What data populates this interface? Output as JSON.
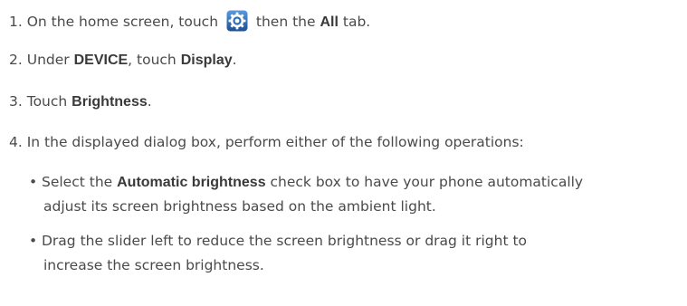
{
  "steps": [
    {
      "num": "1.",
      "pre": "On the home screen, touch",
      "mid": "then the",
      "bold": "All",
      "post": "tab.",
      "icon": "settings-gear-icon"
    },
    {
      "num": "2.",
      "pre": "Under",
      "bold1": "DEVICE",
      "mid": ", touch",
      "bold2": "Display",
      "post": "."
    },
    {
      "num": "3.",
      "pre": "Touch",
      "bold": "Brightness",
      "post": "."
    },
    {
      "num": "4.",
      "text": "In the displayed dialog box, perform either of the following operations:"
    }
  ],
  "bullets": [
    {
      "marker": "•",
      "pre": "Select the",
      "bold": "Automatic brightness",
      "line1_post": "check box to have your phone automatically",
      "line2": "adjust its screen brightness based on the ambient light."
    },
    {
      "marker": "•",
      "line1": "Drag the slider left to reduce the screen brightness or drag it right to",
      "line2": "increase the screen brightness."
    }
  ],
  "colors": {
    "text": "#4a4a4a",
    "icon_blue": "#2a6fb8"
  }
}
